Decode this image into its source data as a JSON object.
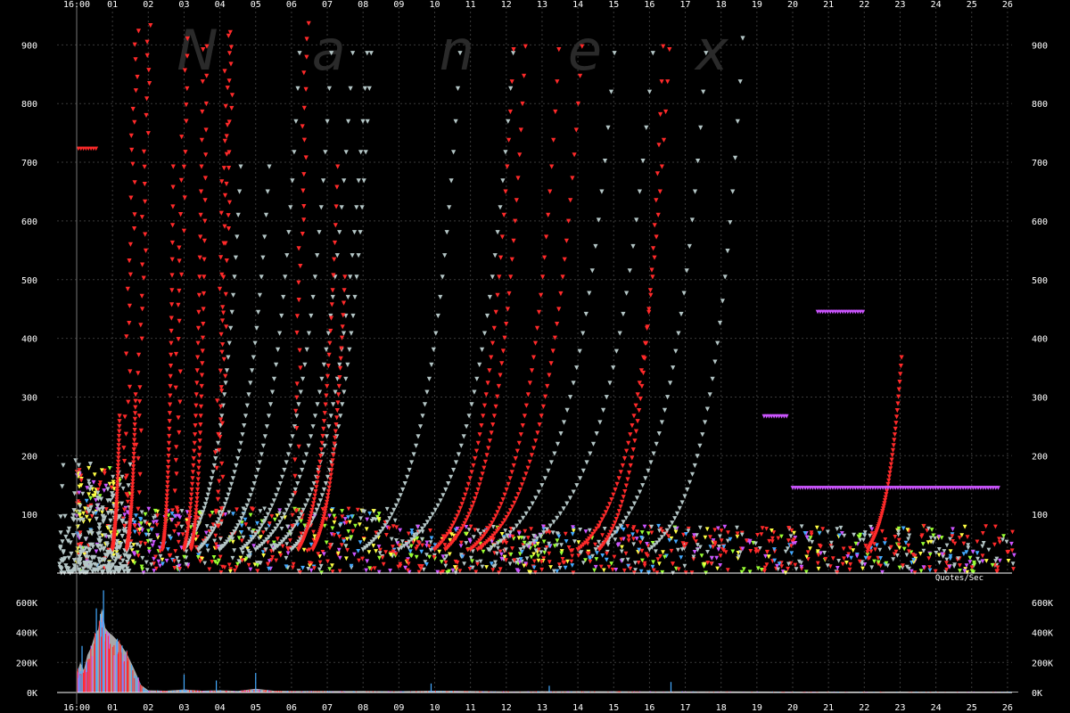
{
  "chart_data": [
    {
      "type": "scatter",
      "role": "quote-activity",
      "watermark": "Nanex",
      "series_label": "Quotes/Sec",
      "x_tick_labels": [
        "16:00",
        "01",
        "02",
        "03",
        "04",
        "05",
        "06",
        "07",
        "08",
        "09",
        "10",
        "11",
        "12",
        "13",
        "14",
        "15",
        "16",
        "17",
        "18",
        "19",
        "20",
        "21",
        "22",
        "23",
        "24",
        "25",
        "26"
      ],
      "ylim": [
        0,
        950
      ],
      "y_ticks": [
        100,
        200,
        300,
        400,
        500,
        600,
        700,
        800,
        900
      ],
      "grid": true,
      "marker": "down-triangle",
      "colors": {
        "red": "#ff2a2a",
        "gray": "#b4c6c6",
        "magenta": "#cc55ff",
        "green": "#99ff33",
        "yellow": "#ffff44",
        "cyan": "#44aaff",
        "grid": "#3a3a3a",
        "axis": "#ffffff"
      },
      "highlighted_levels": [
        {
          "y": 445,
          "x_from": 20.7,
          "x_to": 22.0,
          "color": "magenta"
        },
        {
          "y": 267,
          "x_from": 19.2,
          "x_to": 19.9,
          "color": "magenta"
        },
        {
          "y": 145,
          "x_from": 20.0,
          "x_to": 25.8,
          "color": "magenta"
        },
        {
          "y": 723,
          "x_from": 0.05,
          "x_to": 0.55,
          "color": "red"
        }
      ],
      "red_rising_streaks": [
        {
          "x0": 1.0,
          "dx": 0.2,
          "k": 0.3
        },
        {
          "x0": 1.4,
          "dx": 0.25,
          "k": 0.32
        },
        {
          "x0": 2.4,
          "dx": 0.3,
          "k": 0.45
        },
        {
          "x0": 3.2,
          "dx": 0.45,
          "k": 0.5
        },
        {
          "x0": 3.0,
          "dx": 0.6,
          "k": 0.55
        },
        {
          "x0": 6.2,
          "dx": 1.1,
          "k": 0.45
        },
        {
          "x0": 6.6,
          "dx": 0.9,
          "k": 0.4
        },
        {
          "x0": 10.0,
          "dx": 2.5,
          "k": 0.55
        },
        {
          "x0": 10.3,
          "dx": 2.3,
          "k": 0.5
        },
        {
          "x0": 11.0,
          "dx": 2.8,
          "k": 0.55
        },
        {
          "x0": 11.2,
          "dx": 3.0,
          "k": 0.5
        },
        {
          "x0": 14.0,
          "dx": 2.9,
          "k": 0.55
        },
        {
          "x0": 14.6,
          "dx": 2.2,
          "k": 0.6
        },
        {
          "x0": 22.1,
          "dx": 0.95,
          "k": 0.35
        }
      ],
      "gray_rising_streaks": [
        {
          "x0": 3.0,
          "dx": 1.6,
          "k": 0.45
        },
        {
          "x0": 3.4,
          "dx": 2.0,
          "k": 0.45
        },
        {
          "x0": 4.0,
          "dx": 2.3,
          "k": 0.5
        },
        {
          "x0": 4.6,
          "dx": 2.6,
          "k": 0.5
        },
        {
          "x0": 5.0,
          "dx": 2.8,
          "k": 0.5
        },
        {
          "x0": 5.5,
          "dx": 2.7,
          "k": 0.5
        },
        {
          "x0": 6.0,
          "dx": 2.3,
          "k": 0.5
        },
        {
          "x0": 8.0,
          "dx": 2.8,
          "k": 0.5
        },
        {
          "x0": 9.0,
          "dx": 3.3,
          "k": 0.5
        },
        {
          "x0": 11.5,
          "dx": 4.0,
          "k": 0.55
        },
        {
          "x0": 12.4,
          "dx": 4.2,
          "k": 0.55
        },
        {
          "x0": 14.5,
          "dx": 3.5,
          "k": 0.55
        },
        {
          "x0": 16.0,
          "dx": 3.2,
          "k": 0.6
        }
      ]
    },
    {
      "type": "area",
      "role": "quote-rate",
      "x_tick_labels": [
        "16:00",
        "01",
        "02",
        "03",
        "04",
        "05",
        "06",
        "07",
        "08",
        "09",
        "10",
        "11",
        "12",
        "13",
        "14",
        "15",
        "16",
        "17",
        "18",
        "19",
        "20",
        "21",
        "22",
        "23",
        "24",
        "25",
        "26"
      ],
      "ylim": [
        0,
        700000
      ],
      "y_ticks": [
        0,
        200000,
        400000,
        600000
      ],
      "y_tick_labels": [
        "0K",
        "200K",
        "400K",
        "600K"
      ],
      "grid": true,
      "colors": {
        "fill": "#a8a8a8",
        "red": "#ff2a2a",
        "magenta": "#cc55ff",
        "cyan": "#44aaff"
      },
      "x": [
        0.0,
        0.1,
        0.2,
        0.3,
        0.4,
        0.5,
        0.6,
        0.7,
        0.8,
        0.9,
        1.0,
        1.2,
        1.4,
        1.6,
        1.8,
        2.0,
        2.5,
        3.0,
        3.5,
        4.0,
        4.5,
        5.0,
        5.5,
        6.0,
        7.0,
        8.0,
        9.0,
        10.0,
        12.0,
        14.0,
        16.0,
        18.0,
        20.0,
        22.0,
        24.0,
        26.3
      ],
      "values": [
        120000,
        200000,
        150000,
        250000,
        300000,
        380000,
        420000,
        560000,
        430000,
        400000,
        380000,
        330000,
        260000,
        160000,
        50000,
        15000,
        12000,
        20000,
        12000,
        15000,
        10000,
        25000,
        12000,
        10000,
        10000,
        10000,
        9000,
        12000,
        8000,
        9000,
        8000,
        7000,
        6000,
        6000,
        6000,
        6000
      ],
      "spikes": [
        {
          "x": 0.75,
          "value": 680000
        },
        {
          "x": 0.55,
          "value": 560000
        },
        {
          "x": 0.15,
          "value": 310000
        },
        {
          "x": 3.0,
          "value": 120000
        },
        {
          "x": 3.9,
          "value": 80000
        },
        {
          "x": 5.0,
          "value": 130000
        },
        {
          "x": 9.9,
          "value": 60000
        },
        {
          "x": 13.2,
          "value": 45000
        },
        {
          "x": 16.6,
          "value": 70000
        }
      ]
    }
  ]
}
